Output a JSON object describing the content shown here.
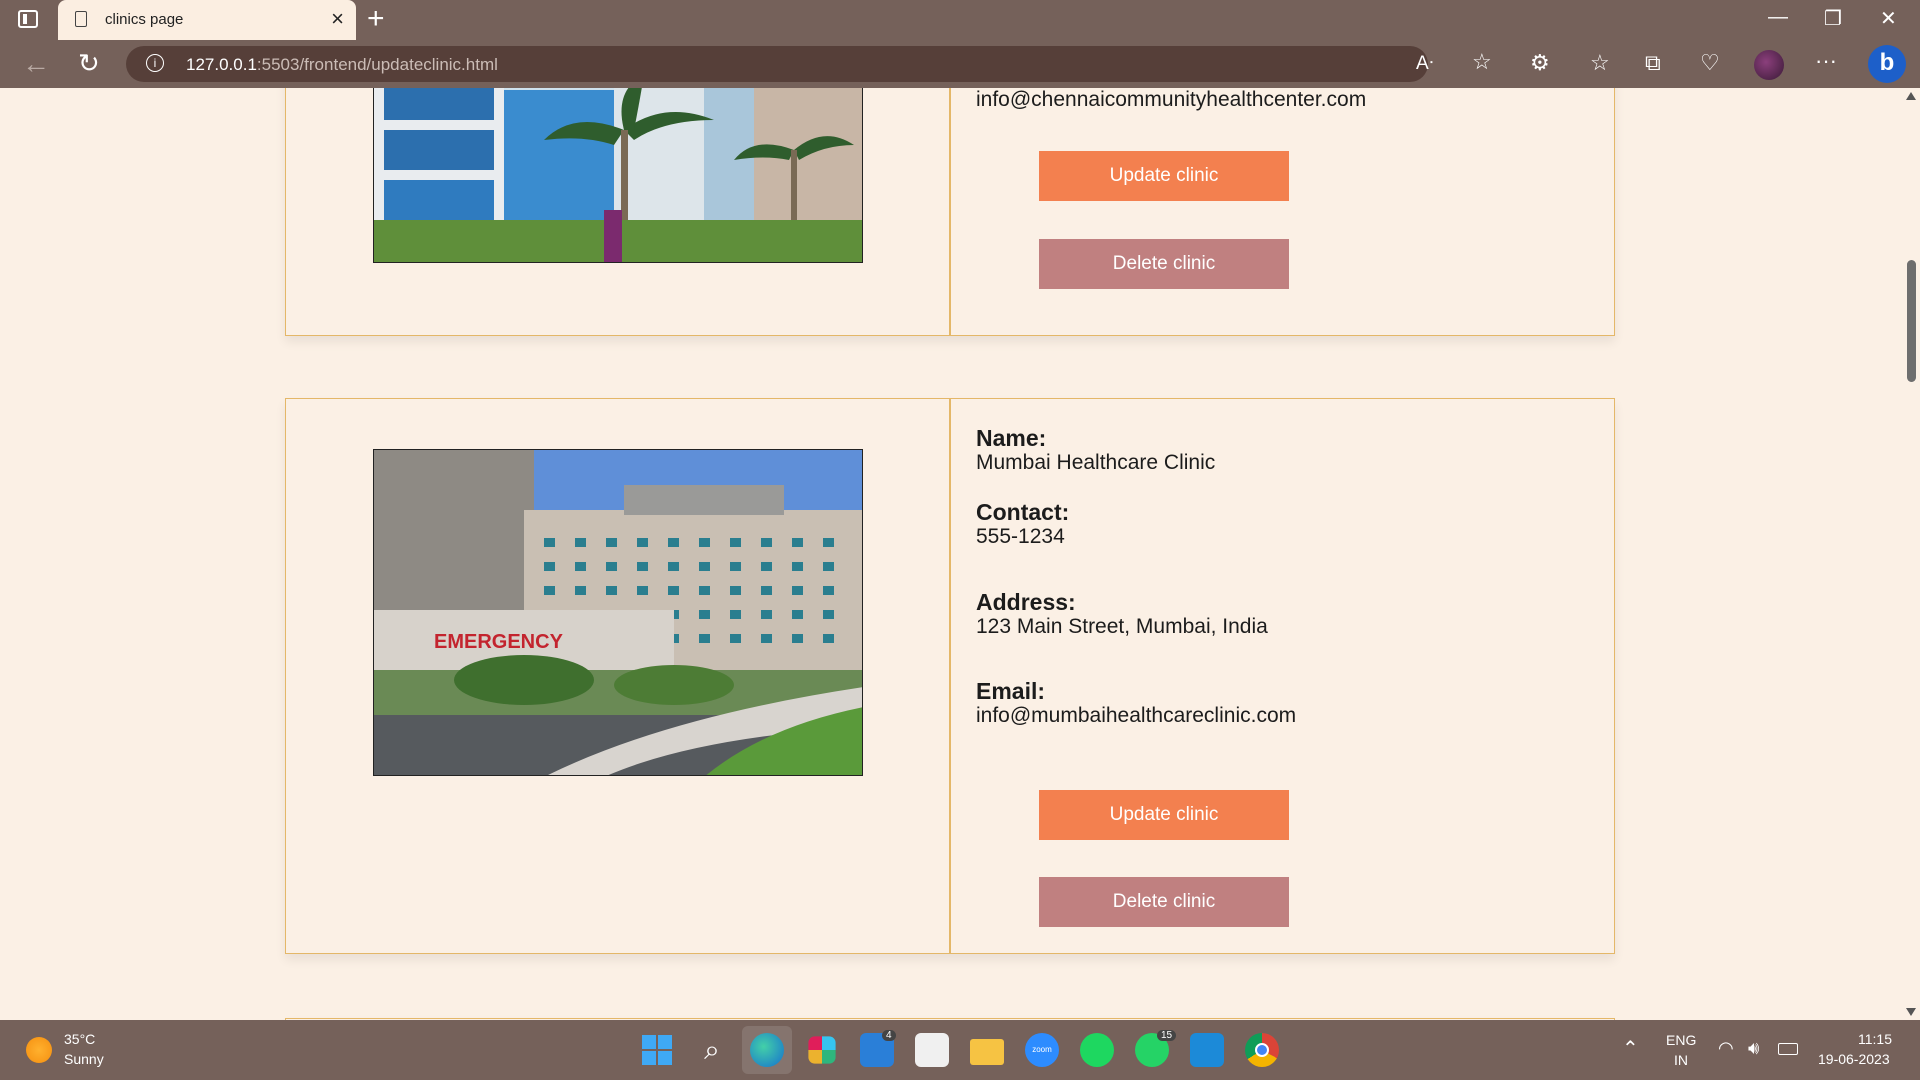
{
  "browser": {
    "tab_title": "clinics page",
    "url_host": "127.0.0.1",
    "url_path": ":5503/frontend/updateclinic.html"
  },
  "clinics": [
    {
      "email": "info@chennaicommunityhealthcenter.com",
      "update_label": "Update clinic",
      "delete_label": "Delete clinic"
    },
    {
      "name_label": "Name:",
      "name": "Mumbai Healthcare Clinic",
      "contact_label": "Contact:",
      "contact": "555-1234",
      "address_label": "Address:",
      "address": "123 Main Street, Mumbai, India",
      "email_label": "Email:",
      "email": "info@mumbaihealthcareclinic.com",
      "update_label": "Update clinic",
      "delete_label": "Delete clinic",
      "image_sign": "EMERGENCY"
    }
  ],
  "colors": {
    "update_button": "#f3804f",
    "delete_button": "#c08080",
    "card_border": "#e4b768",
    "page_bg": "#fbf0e5"
  },
  "taskbar": {
    "temperature": "35°C",
    "weather": "Sunny",
    "mail_badge": "4",
    "whatsapp_badge": "15",
    "zoom_label": "zoom",
    "lang1": "ENG",
    "lang2": "IN",
    "time": "11:15",
    "date": "19-06-2023"
  }
}
